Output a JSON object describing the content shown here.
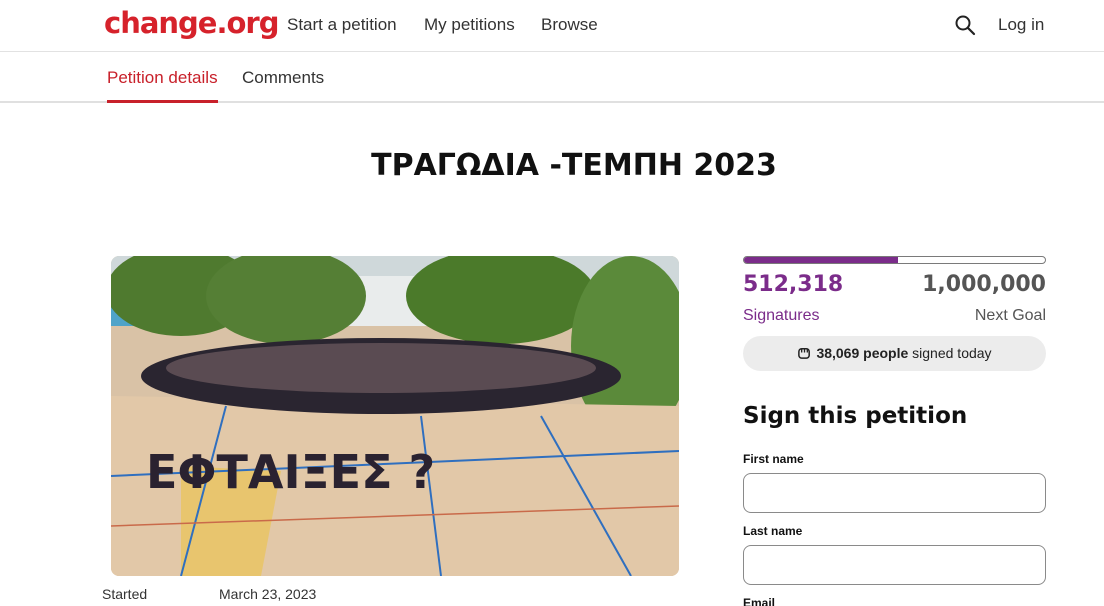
{
  "header": {
    "logo": "change.org",
    "nav": [
      "Start a petition",
      "My petitions",
      "Browse"
    ],
    "login": "Log in",
    "icons": {
      "search": "search-icon"
    }
  },
  "tabs": {
    "details": "Petition details",
    "comments": "Comments"
  },
  "petition": {
    "title": "ΤΡΑΓΩΔΙΑ -ΤΕΜΠΗ 2023",
    "image_text": "ΕΦΤΑΙΞΕΣ ?",
    "started_label": "Started",
    "started_date": "March 23, 2023"
  },
  "signatures": {
    "count": "512,318",
    "count_label": "Signatures",
    "goal": "1,000,000",
    "goal_label": "Next Goal",
    "progress_fraction": 0.512,
    "today_count": "38,069 people",
    "today_suffix": " signed today"
  },
  "form": {
    "heading": "Sign this petition",
    "first_name_label": "First name",
    "first_name_value": "",
    "last_name_label": "Last name",
    "last_name_value": "",
    "email_label": "Email"
  },
  "colors": {
    "brand_red": "#d6222b",
    "accent_purple": "#7b2c8a",
    "tab_active": "#c8202a"
  }
}
